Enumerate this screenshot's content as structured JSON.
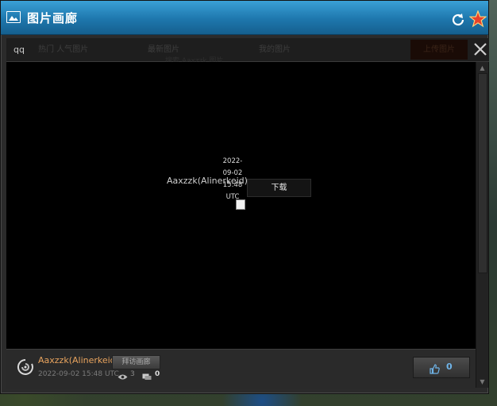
{
  "window": {
    "title": "图片画廊"
  },
  "tabs": {
    "qq": "qq",
    "hot": "热门 人气图片",
    "latest": "最新图片",
    "mine": "我的图片",
    "search_hint": "搜索 Aaxzzk 图片"
  },
  "toolbar": {
    "upload_label": "上传图片"
  },
  "viewer": {
    "author_overlay": "Aaxzzk(Alinerkeid)",
    "date_lines": [
      "2022-",
      "09-02",
      "15:48",
      "UTC"
    ],
    "download_label": "下载"
  },
  "info": {
    "author": "Aaxzzk(Alinerkeid)",
    "visit_label": "拜访画廊",
    "posted": "2022-09-02 15:48 UTC",
    "views": "3",
    "comments": "0",
    "likes": "0"
  },
  "colors": {
    "title_bar": "#1e77ad",
    "author_name": "#e9a45e",
    "like_count": "#6fb4e8"
  },
  "icons": [
    "picture-icon",
    "refresh-icon",
    "star-icon",
    "close-icon",
    "eye-icon",
    "comment-icon",
    "thumbs-up-icon",
    "avatar-icon"
  ]
}
